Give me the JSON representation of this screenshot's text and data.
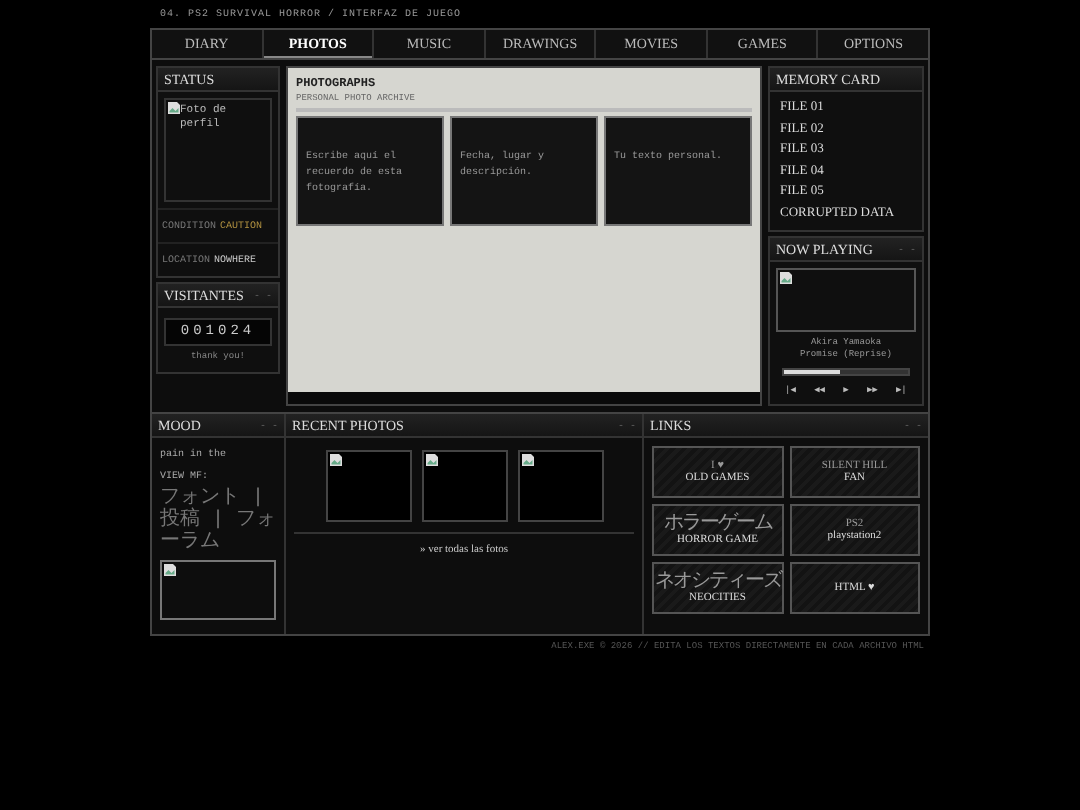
{
  "page_title": "04. PS2 SURVIVAL HORROR / INTERFAZ DE JUEGO",
  "tabs": [
    {
      "label": "DIARY",
      "selected": false
    },
    {
      "label": "PHOTOS",
      "selected": true
    },
    {
      "label": "MUSIC",
      "selected": false
    },
    {
      "label": "DRAWINGS",
      "selected": false
    },
    {
      "label": "MOVIES",
      "selected": false
    },
    {
      "label": "GAMES",
      "selected": false
    },
    {
      "label": "OPTIONS",
      "selected": false
    }
  ],
  "status": {
    "title": "STATUS",
    "avatar_alt": "Foto de perfil",
    "rows": [
      {
        "label": "CONDITION",
        "value": "CAUTION",
        "kind": "warning"
      },
      {
        "label": "LOCATION",
        "value": "NOWHERE",
        "kind": "plain"
      }
    ]
  },
  "visitors": {
    "title": "VISITANTES",
    "controls": "- -",
    "counter": "001024",
    "note": "thank you!"
  },
  "photographs": {
    "title": "PHOTOGRAPHS",
    "subtitle": "PERSONAL PHOTO ARCHIVE",
    "cards": [
      "Escribe aquí el recuerdo de esta fotografía.",
      "Fecha, lugar y descripción.",
      "Tu texto personal."
    ]
  },
  "memory_card": {
    "title": "MEMORY CARD",
    "files": [
      "FILE 01",
      "FILE 02",
      "FILE 03",
      "FILE 04",
      "FILE 05",
      "CORRUPTED DATA"
    ]
  },
  "now_playing": {
    "title": "NOW PLAYING",
    "controls": "- -",
    "artist": "Akira Yamaoka",
    "track": "Promise (Reprise)",
    "level": 0.45,
    "buttons": [
      "|◀",
      "◀◀",
      "▶",
      "▶▶",
      "▶|"
    ]
  },
  "mood": {
    "title": "MOOD",
    "controls": "- -",
    "lines": [
      "pain in the",
      "VIEW MF:"
    ],
    "links": "フォント | 投稿 | フォーラム"
  },
  "recent_photos": {
    "title": "RECENT PHOTOS",
    "controls": "- -",
    "thumbnails": [
      {
        "kind": "broken_image"
      },
      {
        "kind": "broken_image"
      },
      {
        "kind": "broken_image"
      }
    ],
    "link": "» ver todas las fotos"
  },
  "links": {
    "title": "LINKS",
    "controls": "- -",
    "items": [
      {
        "top": "I ♥",
        "bottom": "OLD GAMES"
      },
      {
        "top": "SILENT HILL",
        "bottom": "FAN"
      },
      {
        "top": "ホラーゲーム",
        "bottom": "HORROR GAME"
      },
      {
        "top": "PS2",
        "bottom": "playstation2"
      },
      {
        "top": "ネオシティーズ",
        "bottom": "NEOCITIES"
      },
      {
        "bottom": "HTML ♥"
      }
    ]
  },
  "footer": "ALEX.EXE © 2026 // EDITA LOS TEXTOS DIRECTAMENTE EN CADA ARCHIVO HTML"
}
